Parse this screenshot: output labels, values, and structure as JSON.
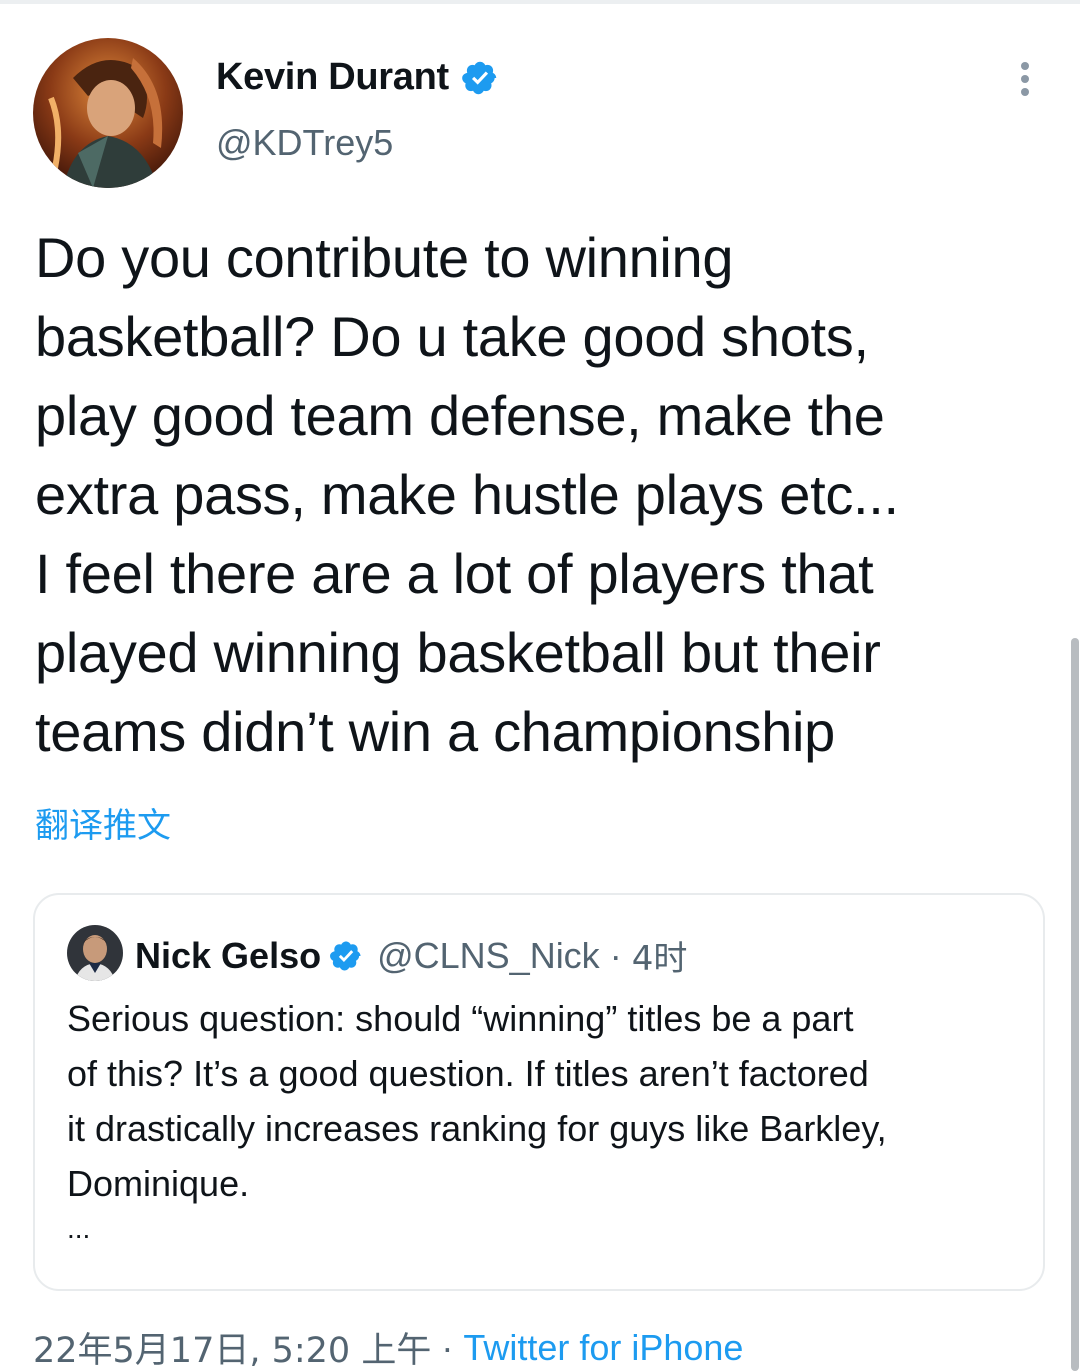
{
  "tweet": {
    "author_name": "Kevin Durant",
    "author_handle": "@KDTrey5",
    "text": "Do you contribute to winning\nbasketball? Do u take good shots,\nplay good team defense, make the\nextra pass, make hustle plays etc...\nI feel there are a lot of players that\nplayed winning basketball but their\nteams didn’t win a championship",
    "translate_label": "翻译推文",
    "timestamp": "22年5月17日, 5:20 上午",
    "separator": "·",
    "source": "Twitter for iPhone"
  },
  "quote": {
    "author_name": "Nick Gelso",
    "author_handle": "@CLNS_Nick",
    "separator": "·",
    "time": "4时",
    "text": "Serious question: should  “winning” titles be a part\nof this? It’s a good question. If titles aren’t factored\nit  drastically increases ranking for guys like Barkley,\nDominique.",
    "ellipsis": "..."
  },
  "icons": {
    "verified": "verified-badge-icon",
    "more": "more-vertical-icon"
  },
  "colors": {
    "accent": "#1d9bf0",
    "secondary_text": "#536471",
    "primary_text": "#0f1419"
  }
}
